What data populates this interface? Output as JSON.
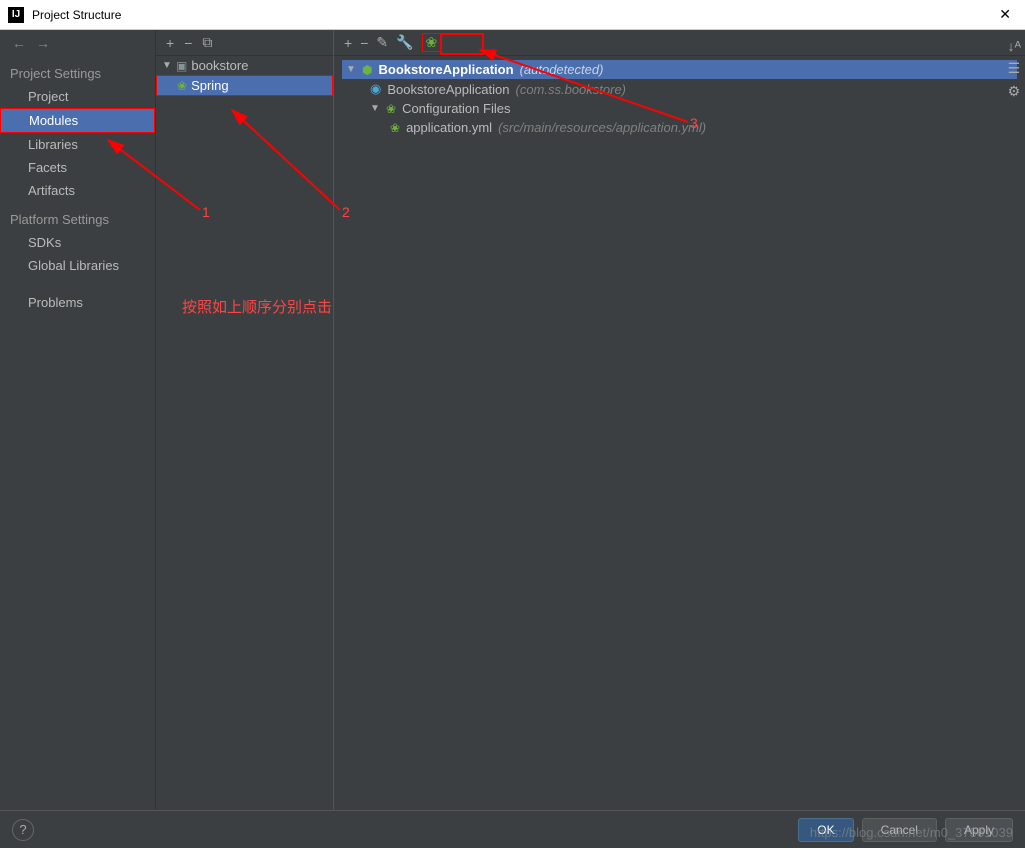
{
  "window": {
    "title": "Project Structure"
  },
  "sidebar": {
    "section1_title": "Project Settings",
    "items1": [
      {
        "label": "Project"
      },
      {
        "label": "Modules"
      },
      {
        "label": "Libraries"
      },
      {
        "label": "Facets"
      },
      {
        "label": "Artifacts"
      }
    ],
    "section2_title": "Platform Settings",
    "items2": [
      {
        "label": "SDKs"
      },
      {
        "label": "Global Libraries"
      }
    ],
    "section3_items": [
      {
        "label": "Problems"
      }
    ]
  },
  "mid": {
    "root": "bookstore",
    "child": "Spring"
  },
  "right": {
    "app_title": "BookstoreApplication",
    "app_note": "(autodetected)",
    "app_sub": "BookstoreApplication",
    "app_sub_pkg": "(com.ss.bookstore)",
    "conf_title": "Configuration Files",
    "conf_file": "application.yml",
    "conf_path": "(src/main/resources/application.yml)"
  },
  "footer": {
    "ok": "OK",
    "cancel": "Cancel",
    "apply": "Apply"
  },
  "annotations": {
    "n1": "1",
    "n2": "2",
    "n3": "3",
    "text": "按照如上顺序分别点击"
  },
  "watermark": "https://blog.csdn.net/m0_37561039"
}
